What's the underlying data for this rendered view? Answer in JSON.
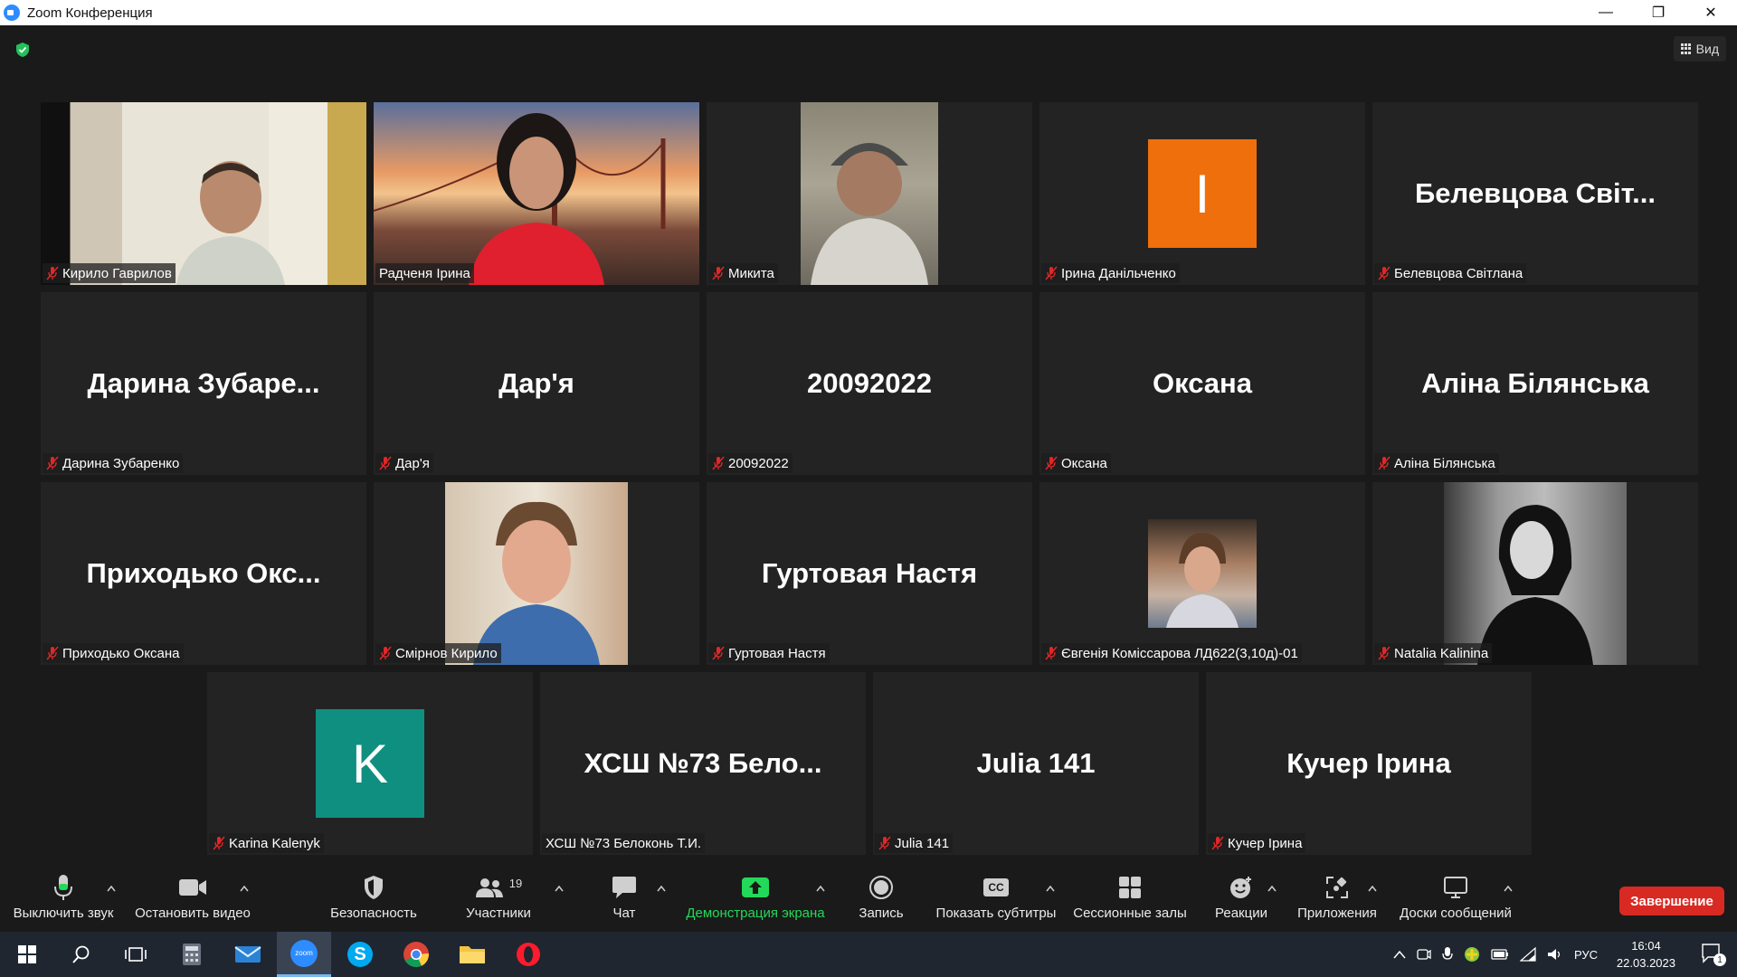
{
  "window": {
    "title": "Zoom Конференция",
    "controls": {
      "minimize": "—",
      "restore": "❐",
      "close": "✕"
    }
  },
  "view_button": {
    "label": "Вид"
  },
  "tiles": [
    {
      "id": "t1",
      "name": "Кирило Гаврилов",
      "big": "",
      "kind": "video",
      "muted": true
    },
    {
      "id": "t2",
      "name": "Радченя Ірина",
      "big": "",
      "kind": "video",
      "muted": false,
      "active": true
    },
    {
      "id": "t3",
      "name": "Микита",
      "big": "",
      "kind": "video",
      "muted": true
    },
    {
      "id": "t4",
      "name": "Ірина Данільченко",
      "big": "",
      "kind": "avatar",
      "avatar_letter": "I",
      "avatar_color": "#ee6f0c",
      "muted": true
    },
    {
      "id": "t5",
      "name": "Белевцова Світлана",
      "big": "Белевцова  Світ...",
      "kind": "name",
      "muted": true
    },
    {
      "id": "t6",
      "name": "Дарина Зубаренко",
      "big": "Дарина  Зубаре...",
      "kind": "name",
      "muted": true
    },
    {
      "id": "t7",
      "name": "Дар'я",
      "big": "Дар'я",
      "kind": "name",
      "muted": true
    },
    {
      "id": "t8",
      "name": "20092022",
      "big": "20092022",
      "kind": "name",
      "muted": true
    },
    {
      "id": "t9",
      "name": "Оксана",
      "big": "Оксана",
      "kind": "name",
      "muted": true
    },
    {
      "id": "t10",
      "name": "Аліна Білянська",
      "big": "Аліна Білянська",
      "kind": "name",
      "muted": true
    },
    {
      "id": "t11",
      "name": "Приходько Оксана",
      "big": "Приходько  Окс...",
      "kind": "name",
      "muted": true
    },
    {
      "id": "t12",
      "name": "Смірнов Кирило",
      "big": "",
      "kind": "video",
      "muted": true
    },
    {
      "id": "t13",
      "name": "Гуртовая Настя",
      "big": "Гуртовая Настя",
      "kind": "name",
      "muted": true
    },
    {
      "id": "t14",
      "name": "Євгенія Коміссарова ЛД622(3,10д)-01",
      "big": "",
      "kind": "video",
      "muted": true
    },
    {
      "id": "t15",
      "name": "Natalia Kalinina",
      "big": "",
      "kind": "video",
      "muted": true
    },
    {
      "id": "t16",
      "name": "Karina Kalenyk",
      "big": "",
      "kind": "avatar",
      "avatar_letter": "K",
      "avatar_color": "#0f8f80",
      "muted": true
    },
    {
      "id": "t17",
      "name": "ХСШ №73 Белоконь Т.И.",
      "big": "ХСШ  №73  Бело...",
      "kind": "name",
      "muted": false
    },
    {
      "id": "t18",
      "name": "Julia 141",
      "big": "Julia 141",
      "kind": "name",
      "muted": true
    },
    {
      "id": "t19",
      "name": "Кучер Ірина",
      "big": "Кучер Ірина",
      "kind": "name",
      "muted": true
    }
  ],
  "toolbar": {
    "mute": "Выключить звук",
    "video": "Остановить видео",
    "security": "Безопасность",
    "participants": "Участники",
    "participants_count": "19",
    "chat": "Чат",
    "share": "Демонстрация экрана",
    "record": "Запись",
    "captions": "Показать субтитры",
    "captions_icon": "CC",
    "breakout": "Сессионные залы",
    "reactions": "Реакции",
    "apps": "Приложения",
    "whiteboards": "Доски сообщений",
    "end": "Завершение"
  },
  "colors": {
    "share_green": "#23d959",
    "end_red": "#d82a22",
    "active_speaker": "#d9e25c",
    "mute_red": "#e02828"
  },
  "taskbar": {
    "zoom_icon_text": "zoom",
    "lang": "РУС",
    "time": "16:04",
    "date": "22.03.2023",
    "notifications": "1"
  }
}
